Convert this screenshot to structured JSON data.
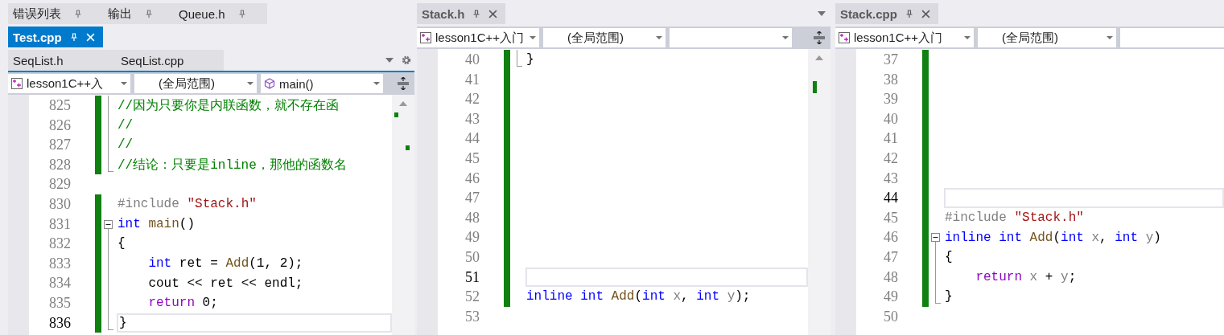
{
  "panes": [
    {
      "focused": true,
      "scrollbar": true,
      "tab_menu": true,
      "settings": true,
      "split_button": true,
      "tab_rows": [
        [
          {
            "kind": "tool",
            "label": "错误列表",
            "selected": false
          },
          {
            "kind": "tool",
            "label": "输出",
            "selected": false
          },
          {
            "kind": "tool",
            "label": "Queue.h",
            "selected": false
          }
        ],
        [
          {
            "kind": "document",
            "label": "Test.cpp",
            "selected": true
          }
        ],
        [
          {
            "kind": "document",
            "label": "SeqList.h",
            "selected": false
          },
          {
            "kind": "document",
            "label": "SeqList.cpp",
            "selected": false
          }
        ]
      ],
      "nav": [
        {
          "kind": "project",
          "text": "lesson1C++入"
        },
        {
          "kind": "scope",
          "text": "(全局范围)"
        },
        {
          "kind": "function",
          "text": "main()"
        }
      ],
      "lines": [
        {
          "number": "825",
          "modified": true,
          "current": false,
          "collapsible": false,
          "in_block": true,
          "block_end": false,
          "tokens": [
            {
              "kind": "comment",
              "text": "//因为只要你是内联函数，就不存在函"
            }
          ]
        },
        {
          "number": "826",
          "modified": true,
          "current": false,
          "collapsible": false,
          "in_block": true,
          "block_end": false,
          "tokens": [
            {
              "kind": "comment",
              "text": "//"
            }
          ]
        },
        {
          "number": "827",
          "modified": true,
          "current": false,
          "collapsible": false,
          "in_block": true,
          "block_end": false,
          "tokens": [
            {
              "kind": "comment",
              "text": "//"
            }
          ]
        },
        {
          "number": "828",
          "modified": true,
          "current": false,
          "collapsible": false,
          "in_block": false,
          "block_end": true,
          "tokens": [
            {
              "kind": "comment",
              "text": "//结论：只要是inline，那他的函数名"
            }
          ]
        },
        {
          "number": "829",
          "modified": false,
          "current": false,
          "collapsible": false,
          "in_block": false,
          "block_end": false
        },
        {
          "number": "830",
          "modified": true,
          "current": false,
          "collapsible": false,
          "in_block": false,
          "block_end": false,
          "tokens": [
            {
              "kind": "preproc",
              "text": "#include "
            },
            {
              "kind": "string",
              "text": "\"Stack.h\""
            }
          ]
        },
        {
          "number": "831",
          "modified": true,
          "current": false,
          "collapsible": true,
          "in_block": false,
          "block_end": false,
          "tokens": [
            {
              "kind": "keyword",
              "text": "int"
            },
            {
              "kind": "function",
              "text": " main"
            },
            {
              "kind": "plain",
              "text": "()"
            }
          ]
        },
        {
          "number": "832",
          "modified": true,
          "current": false,
          "collapsible": false,
          "in_block": true,
          "block_end": false,
          "tokens": [
            {
              "kind": "plain",
              "text": "{"
            }
          ]
        },
        {
          "number": "833",
          "modified": true,
          "current": false,
          "collapsible": false,
          "in_block": true,
          "block_end": false,
          "tokens": [
            {
              "kind": "keyword",
              "text": "    int"
            },
            {
              "kind": "plain",
              "text": " ret = "
            },
            {
              "kind": "function",
              "text": "Add"
            },
            {
              "kind": "plain",
              "text": "(1, 2);"
            }
          ]
        },
        {
          "number": "834",
          "modified": true,
          "current": false,
          "collapsible": false,
          "in_block": true,
          "block_end": false,
          "tokens": [
            {
              "kind": "plain",
              "text": "    cout << ret << endl;"
            }
          ]
        },
        {
          "number": "835",
          "modified": true,
          "current": false,
          "collapsible": false,
          "in_block": true,
          "block_end": false,
          "tokens": [
            {
              "kind": "control",
              "text": "    return"
            },
            {
              "kind": "plain",
              "text": " 0;"
            }
          ]
        },
        {
          "number": "836",
          "modified": true,
          "current": true,
          "collapsible": false,
          "in_block": false,
          "block_end": true,
          "tokens": [
            {
              "kind": "plain",
              "text": "}"
            }
          ]
        }
      ]
    },
    {
      "focused": false,
      "scrollbar": true,
      "tab_menu": true,
      "settings": false,
      "split_button": true,
      "tab_rows": [
        [
          {
            "kind": "document",
            "label": "Stack.h",
            "selected": true
          }
        ]
      ],
      "nav": [
        {
          "kind": "project",
          "text": "lesson1C++入门"
        },
        {
          "kind": "scope",
          "text": "(全局范围)"
        },
        {
          "kind": "member"
        }
      ],
      "lines": [
        {
          "number": "40",
          "modified": true,
          "current": false,
          "collapsible": false,
          "in_block": false,
          "block_end": true,
          "tokens": [
            {
              "kind": "plain",
              "text": "}"
            }
          ]
        },
        {
          "number": "41",
          "modified": true,
          "current": false,
          "collapsible": false,
          "in_block": false,
          "block_end": false
        },
        {
          "number": "42",
          "modified": true,
          "current": false,
          "collapsible": false,
          "in_block": false,
          "block_end": false
        },
        {
          "number": "43",
          "modified": true,
          "current": false,
          "collapsible": false,
          "in_block": false,
          "block_end": false
        },
        {
          "number": "44",
          "modified": true,
          "current": false,
          "collapsible": false,
          "in_block": false,
          "block_end": false
        },
        {
          "number": "45",
          "modified": true,
          "current": false,
          "collapsible": false,
          "in_block": false,
          "block_end": false
        },
        {
          "number": "46",
          "modified": true,
          "current": false,
          "collapsible": false,
          "in_block": false,
          "block_end": false
        },
        {
          "number": "47",
          "modified": true,
          "current": false,
          "collapsible": false,
          "in_block": false,
          "block_end": false
        },
        {
          "number": "48",
          "modified": true,
          "current": false,
          "collapsible": false,
          "in_block": false,
          "block_end": false
        },
        {
          "number": "49",
          "modified": true,
          "current": false,
          "collapsible": false,
          "in_block": false,
          "block_end": false
        },
        {
          "number": "50",
          "modified": true,
          "current": false,
          "collapsible": false,
          "in_block": false,
          "block_end": false
        },
        {
          "number": "51",
          "modified": true,
          "current": true,
          "collapsible": false,
          "in_block": false,
          "block_end": false
        },
        {
          "number": "52",
          "modified": true,
          "current": false,
          "collapsible": false,
          "in_block": false,
          "block_end": false,
          "tokens": [
            {
              "kind": "keyword",
              "text": "inline int"
            },
            {
              "kind": "function",
              "text": " Add"
            },
            {
              "kind": "plain",
              "text": "("
            },
            {
              "kind": "keyword",
              "text": "int"
            },
            {
              "kind": "param",
              "text": " x"
            },
            {
              "kind": "plain",
              "text": ", "
            },
            {
              "kind": "keyword",
              "text": "int"
            },
            {
              "kind": "param",
              "text": " y"
            },
            {
              "kind": "plain",
              "text": ");"
            }
          ]
        },
        {
          "number": "53",
          "modified": false,
          "current": false,
          "collapsible": false,
          "in_block": false,
          "block_end": false
        }
      ]
    },
    {
      "focused": false,
      "scrollbar": false,
      "tab_menu": false,
      "settings": false,
      "split_button": false,
      "tab_rows": [
        [
          {
            "kind": "document",
            "label": "Stack.cpp",
            "selected": true
          }
        ]
      ],
      "nav": [
        {
          "kind": "project",
          "text": "lesson1C++入门"
        },
        {
          "kind": "scope",
          "text": "(全局范围)"
        },
        {
          "kind": "member"
        }
      ],
      "lines": [
        {
          "number": "37",
          "modified": true,
          "current": false,
          "collapsible": false,
          "in_block": false,
          "block_end": false
        },
        {
          "number": "38",
          "modified": true,
          "current": false,
          "collapsible": false,
          "in_block": false,
          "block_end": false
        },
        {
          "number": "39",
          "modified": true,
          "current": false,
          "collapsible": false,
          "in_block": false,
          "block_end": false
        },
        {
          "number": "40",
          "modified": true,
          "current": false,
          "collapsible": false,
          "in_block": false,
          "block_end": false
        },
        {
          "number": "41",
          "modified": true,
          "current": false,
          "collapsible": false,
          "in_block": false,
          "block_end": false
        },
        {
          "number": "42",
          "modified": true,
          "current": false,
          "collapsible": false,
          "in_block": false,
          "block_end": false
        },
        {
          "number": "43",
          "modified": true,
          "current": false,
          "collapsible": false,
          "in_block": false,
          "block_end": false
        },
        {
          "number": "44",
          "modified": true,
          "current": true,
          "collapsible": false,
          "in_block": false,
          "block_end": false
        },
        {
          "number": "45",
          "modified": true,
          "current": false,
          "collapsible": false,
          "in_block": false,
          "block_end": false,
          "tokens": [
            {
              "kind": "preproc",
              "text": "#include "
            },
            {
              "kind": "string",
              "text": "\"Stack.h\""
            }
          ]
        },
        {
          "number": "46",
          "modified": true,
          "current": false,
          "collapsible": true,
          "in_block": false,
          "block_end": false,
          "tokens": [
            {
              "kind": "keyword",
              "text": "inline int"
            },
            {
              "kind": "function",
              "text": " Add"
            },
            {
              "kind": "plain",
              "text": "("
            },
            {
              "kind": "keyword",
              "text": "int"
            },
            {
              "kind": "param",
              "text": " x"
            },
            {
              "kind": "plain",
              "text": ", "
            },
            {
              "kind": "keyword",
              "text": "int"
            },
            {
              "kind": "param",
              "text": " y"
            },
            {
              "kind": "plain",
              "text": ")"
            }
          ]
        },
        {
          "number": "47",
          "modified": true,
          "current": false,
          "collapsible": false,
          "in_block": true,
          "block_end": false,
          "tokens": [
            {
              "kind": "plain",
              "text": "{"
            }
          ]
        },
        {
          "number": "48",
          "modified": true,
          "current": false,
          "collapsible": false,
          "in_block": true,
          "block_end": false,
          "tokens": [
            {
              "kind": "control",
              "text": "    return"
            },
            {
              "kind": "param",
              "text": " x"
            },
            {
              "kind": "plain",
              "text": " + "
            },
            {
              "kind": "param",
              "text": "y"
            },
            {
              "kind": "plain",
              "text": ";"
            }
          ]
        },
        {
          "number": "49",
          "modified": true,
          "current": false,
          "collapsible": false,
          "in_block": false,
          "block_end": true,
          "tokens": [
            {
              "kind": "plain",
              "text": "}"
            }
          ]
        },
        {
          "number": "50",
          "modified": false,
          "current": false,
          "collapsible": false,
          "in_block": false,
          "block_end": false
        }
      ]
    }
  ]
}
